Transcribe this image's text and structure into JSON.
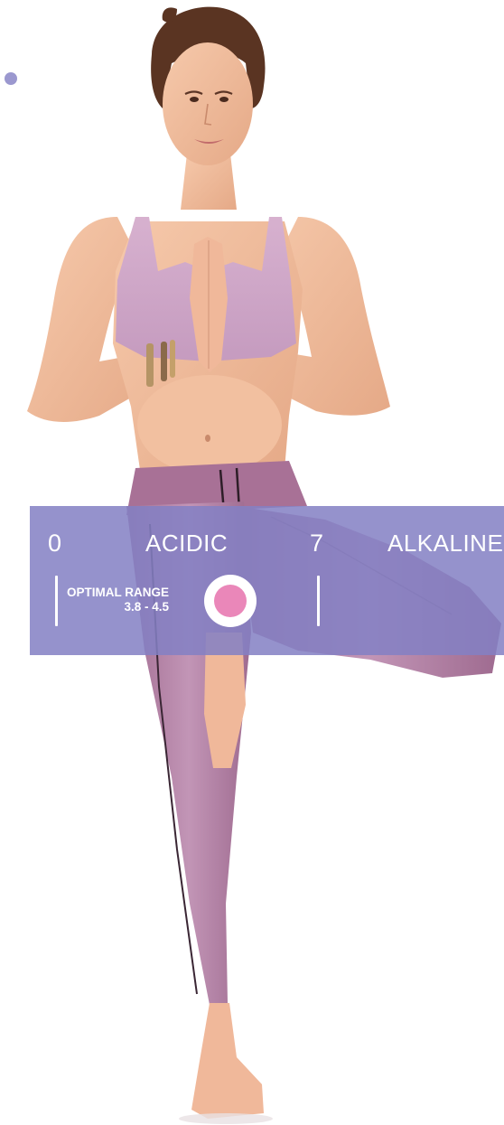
{
  "image": {
    "description_icon": "yoga-woman-photo"
  },
  "colors": {
    "band": "#8480c4",
    "marker_fill": "#ea87b9",
    "accent_dot": "#9b98cf"
  },
  "scale": {
    "left_number": "0",
    "left_label": "ACIDIC",
    "mid_number": "7",
    "right_label": "ALKALINE",
    "optimal_title": "OPTIMAL RANGE",
    "optimal_value": "3.8 - 4.5"
  }
}
